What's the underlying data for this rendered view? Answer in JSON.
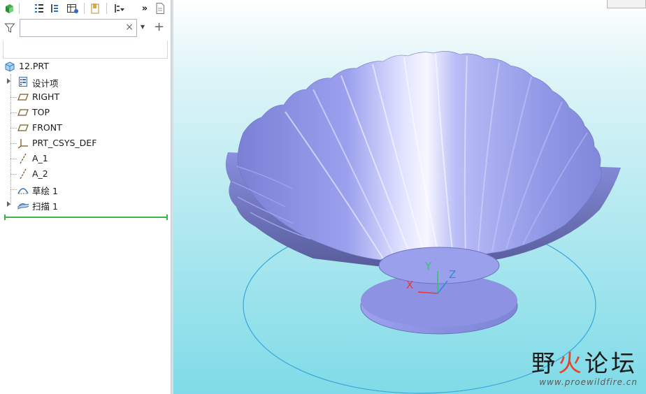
{
  "model_tree": {
    "search": {
      "value": "",
      "clear_glyph": "×"
    },
    "toolbar": {
      "overflow_glyph": "»",
      "add_glyph": "+",
      "dropdown_glyph": "▾"
    },
    "root": {
      "label": "12.PRT",
      "icon": "part-icon"
    },
    "items": [
      {
        "label": "设计项",
        "icon": "design-items-icon",
        "expandable": true
      },
      {
        "label": "RIGHT",
        "icon": "datum-plane-icon",
        "expandable": false
      },
      {
        "label": "TOP",
        "icon": "datum-plane-icon",
        "expandable": false
      },
      {
        "label": "FRONT",
        "icon": "datum-plane-icon",
        "expandable": false
      },
      {
        "label": "PRT_CSYS_DEF",
        "icon": "csys-icon",
        "expandable": false
      },
      {
        "label": "A_1",
        "icon": "datum-axis-icon",
        "expandable": false
      },
      {
        "label": "A_2",
        "icon": "datum-axis-icon",
        "expandable": false
      },
      {
        "label": "草绘 1",
        "icon": "sketch-icon",
        "expandable": false
      },
      {
        "label": "扫描 1",
        "icon": "sweep-icon",
        "expandable": true
      }
    ]
  },
  "viewport": {
    "csys_labels": {
      "x": "X",
      "y": "Y",
      "z": "Z"
    },
    "colors": {
      "surface": "#8f96ea",
      "highlight": "#f4f5ff",
      "shadow": "#5a5f9e",
      "sketch_circle": "#3aa6d8"
    }
  },
  "watermark": {
    "title_a": "野",
    "title_b": "火",
    "title_c": "论坛",
    "url": "www.proewildfire.cn"
  }
}
